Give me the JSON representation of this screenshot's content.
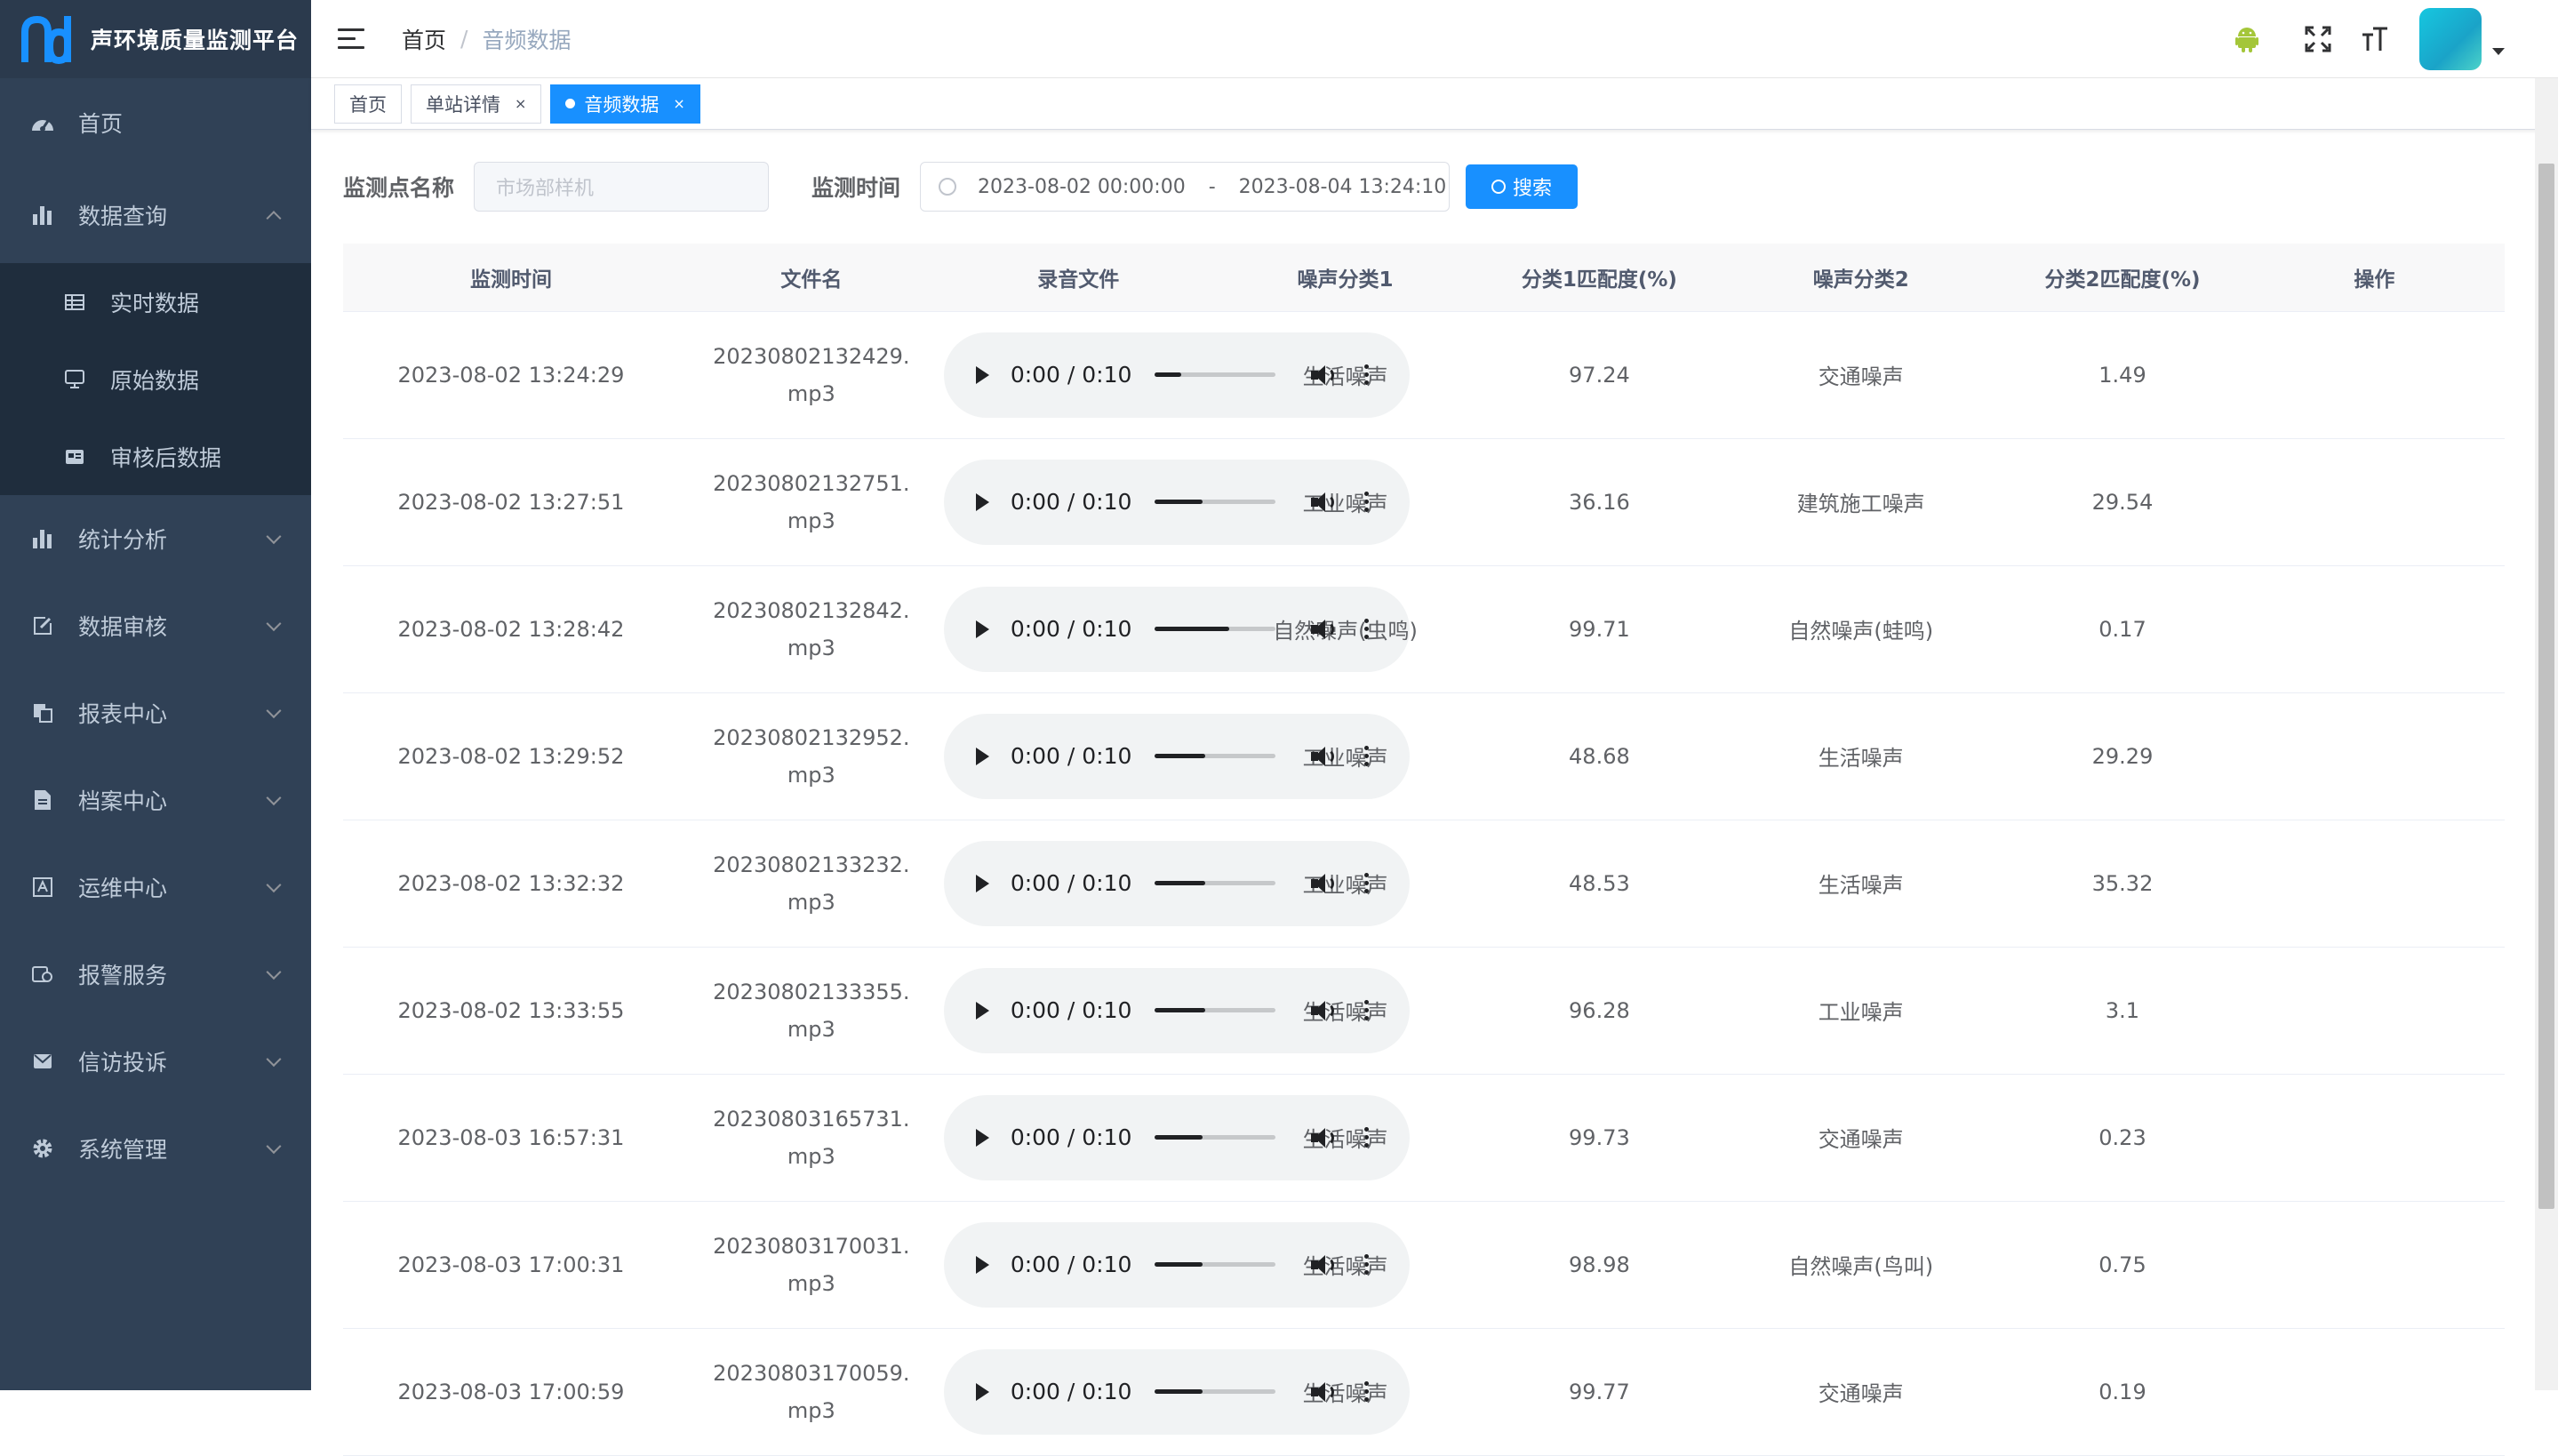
{
  "app": {
    "title": "声环境质量监测平台"
  },
  "sidebar": {
    "items": [
      {
        "label": "首页",
        "icon": "dashboard-icon"
      },
      {
        "label": "数据查询",
        "icon": "bar-chart-icon",
        "expanded": true,
        "children": [
          {
            "label": "实时数据",
            "icon": "table-icon"
          },
          {
            "label": "原始数据",
            "icon": "monitor-icon"
          },
          {
            "label": "审核后数据",
            "icon": "card-icon"
          }
        ]
      },
      {
        "label": "统计分析",
        "icon": "bar-chart-icon"
      },
      {
        "label": "数据审核",
        "icon": "edit-icon"
      },
      {
        "label": "报表中心",
        "icon": "copy-icon"
      },
      {
        "label": "档案中心",
        "icon": "document-icon"
      },
      {
        "label": "运维中心",
        "icon": "tools-icon"
      },
      {
        "label": "报警服务",
        "icon": "alarm-icon"
      },
      {
        "label": "信访投诉",
        "icon": "message-icon"
      },
      {
        "label": "系统管理",
        "icon": "gear-icon"
      }
    ]
  },
  "header": {
    "breadcrumb": {
      "home": "首页",
      "separator": "/",
      "current": "音频数据"
    }
  },
  "tags": [
    {
      "label": "首页",
      "active": false
    },
    {
      "label": "单站详情",
      "active": false,
      "close": "×"
    },
    {
      "label": "音频数据",
      "active": true,
      "close": "×"
    }
  ],
  "search": {
    "station_label": "监测点名称",
    "station_placeholder": "市场部样机",
    "time_label": "监测时间",
    "start": "2023-08-02 00:00:00",
    "range_sep": "-",
    "end": "2023-08-04 13:24:10",
    "button": "搜索"
  },
  "table": {
    "columns": [
      "监测时间",
      "文件名",
      "录音文件",
      "噪声分类1",
      "分类1匹配度(%)",
      "噪声分类2",
      "分类2匹配度(%)",
      "操作"
    ],
    "rows": [
      {
        "time": "2023-08-02 13:24:29",
        "file1": "20230802132429.",
        "file2": "mp3",
        "player": "0:00 / 0:10",
        "progress": 0.22,
        "c1": "生活噪声",
        "m1": "97.24",
        "c2": "交通噪声",
        "m2": "1.49"
      },
      {
        "time": "2023-08-02 13:27:51",
        "file1": "20230802132751.",
        "file2": "mp3",
        "player": "0:00 / 0:10",
        "progress": 0.4,
        "c1": "工业噪声",
        "m1": "36.16",
        "c2": "建筑施工噪声",
        "m2": "29.54"
      },
      {
        "time": "2023-08-02 13:28:42",
        "file1": "20230802132842.",
        "file2": "mp3",
        "player": "0:00 / 0:10",
        "progress": 0.62,
        "c1": "自然噪声(虫鸣)",
        "m1": "99.71",
        "c2": "自然噪声(蛙鸣)",
        "m2": "0.17"
      },
      {
        "time": "2023-08-02 13:29:52",
        "file1": "20230802132952.",
        "file2": "mp3",
        "player": "0:00 / 0:10",
        "progress": 0.42,
        "c1": "工业噪声",
        "m1": "48.68",
        "c2": "生活噪声",
        "m2": "29.29"
      },
      {
        "time": "2023-08-02 13:32:32",
        "file1": "20230802133232.",
        "file2": "mp3",
        "player": "0:00 / 0:10",
        "progress": 0.42,
        "c1": "工业噪声",
        "m1": "48.53",
        "c2": "生活噪声",
        "m2": "35.32"
      },
      {
        "time": "2023-08-02 13:33:55",
        "file1": "20230802133355.",
        "file2": "mp3",
        "player": "0:00 / 0:10",
        "progress": 0.42,
        "c1": "生活噪声",
        "m1": "96.28",
        "c2": "工业噪声",
        "m2": "3.1"
      },
      {
        "time": "2023-08-03 16:57:31",
        "file1": "20230803165731.",
        "file2": "mp3",
        "player": "0:00 / 0:10",
        "progress": 0.4,
        "c1": "生活噪声",
        "m1": "99.73",
        "c2": "交通噪声",
        "m2": "0.23"
      },
      {
        "time": "2023-08-03 17:00:31",
        "file1": "20230803170031.",
        "file2": "mp3",
        "player": "0:00 / 0:10",
        "progress": 0.4,
        "c1": "生活噪声",
        "m1": "98.98",
        "c2": "自然噪声(鸟叫)",
        "m2": "0.75"
      },
      {
        "time": "2023-08-03 17:00:59",
        "file1": "20230803170059.",
        "file2": "mp3",
        "player": "0:00 / 0:10",
        "progress": 0.4,
        "c1": "生活噪声",
        "m1": "99.77",
        "c2": "交通噪声",
        "m2": "0.19"
      }
    ]
  },
  "colors": {
    "sidebar": "#304156",
    "submenu": "#1f2d3d",
    "accent": "#1890ff",
    "android": "#a4c639"
  }
}
